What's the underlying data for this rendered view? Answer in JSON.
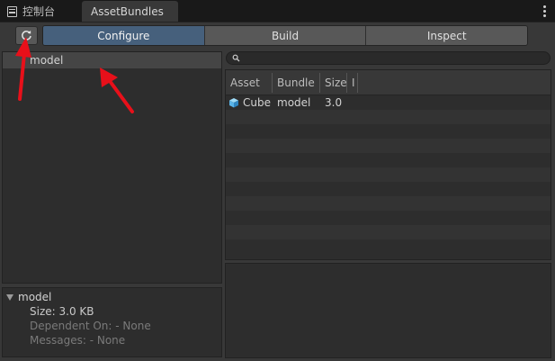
{
  "tabs": {
    "console_label": "控制台",
    "assetbundles_label": "AssetBundles"
  },
  "toolbar": {
    "modes": [
      "Configure",
      "Build",
      "Inspect"
    ],
    "active_mode": "Configure"
  },
  "bundle_list": {
    "items": [
      {
        "label": "model"
      }
    ]
  },
  "detail": {
    "title": "model",
    "size": "Size: 3.0 KB",
    "dependent_on": "Dependent On: - None",
    "messages": "Messages: - None"
  },
  "search": {
    "value": "",
    "placeholder": ""
  },
  "asset_table": {
    "headers": [
      "Asset",
      "Bundle",
      "Size",
      "I"
    ],
    "rows": [
      {
        "asset": "Cube",
        "bundle": "model",
        "size": "3.0"
      }
    ]
  },
  "colors": {
    "accent_active_tab": "#46607c",
    "annotation_arrow": "#e8101a",
    "cube_icon": "#5ab4e8"
  },
  "icons": {
    "refresh": "refresh-icon",
    "console": "console-icon",
    "menu": "more-vertical-icon",
    "search": "search-icon",
    "cube": "cube-icon",
    "foldout": "triangle-down-icon"
  }
}
